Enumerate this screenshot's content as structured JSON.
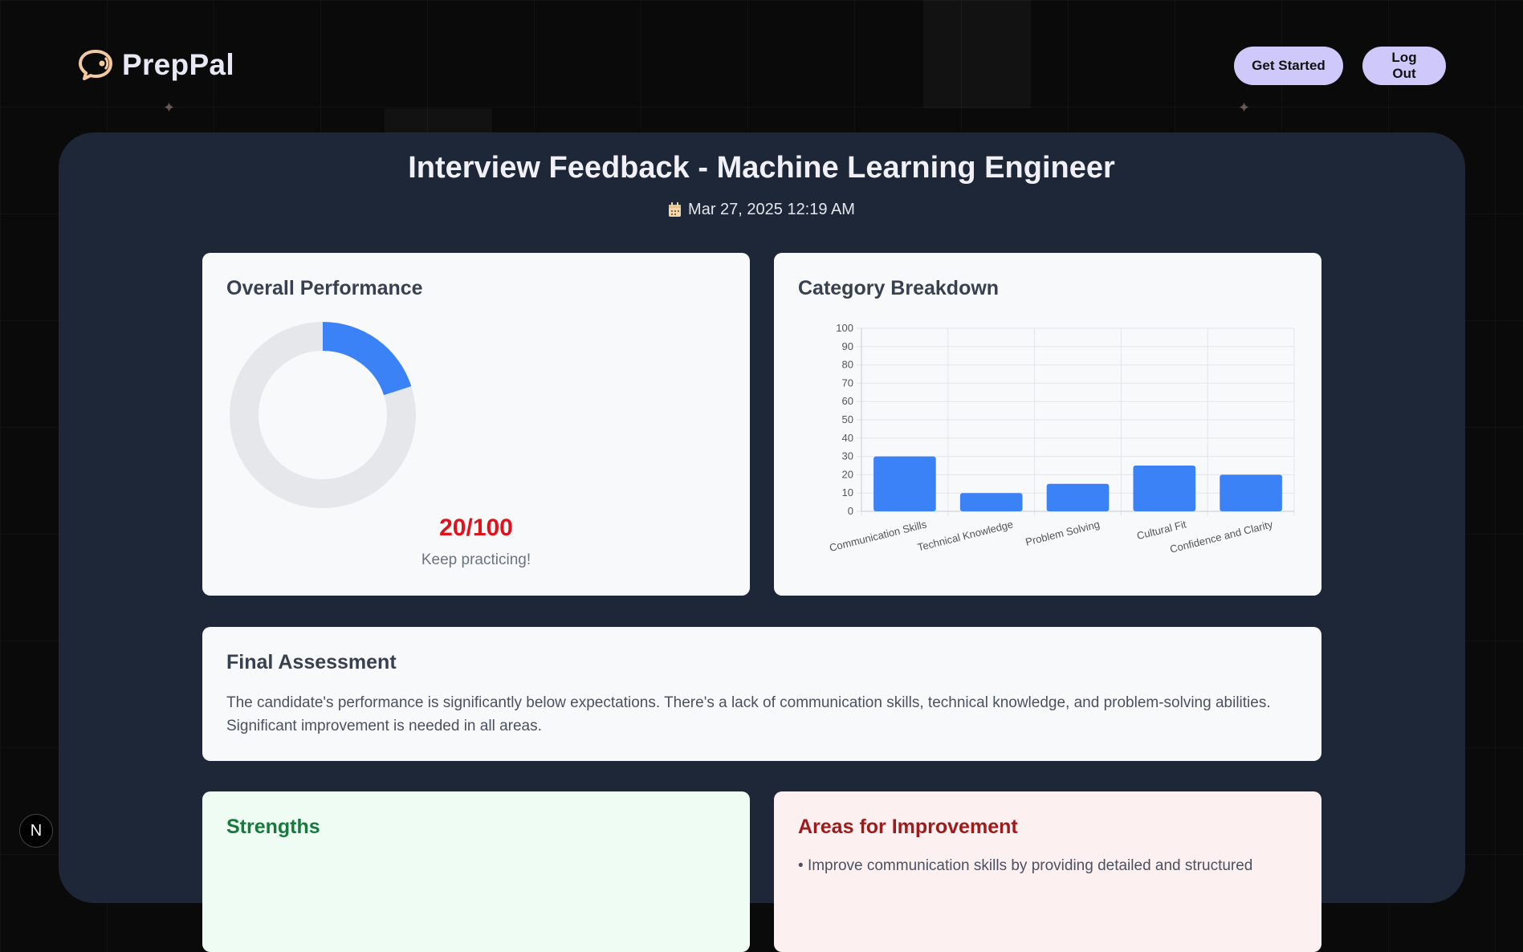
{
  "app": {
    "name": "PrepPal"
  },
  "header": {
    "get_started_label": "Get Started",
    "logout_label": "Log Out"
  },
  "page": {
    "title": "Interview Feedback - Machine Learning Engineer",
    "date": "Mar 27, 2025 12:19 AM"
  },
  "overall": {
    "heading": "Overall Performance",
    "score_text": "20/100",
    "score_fraction": 0.2,
    "message": "Keep practicing!",
    "colors": {
      "fill": "#3b82f6",
      "track": "#e5e7eb",
      "score": "#e0131d"
    }
  },
  "category": {
    "heading": "Category Breakdown"
  },
  "chart_data": {
    "type": "bar",
    "categories": [
      "Communication Skills",
      "Technical Knowledge",
      "Problem Solving",
      "Cultural Fit",
      "Confidence and Clarity"
    ],
    "values": [
      30,
      10,
      15,
      25,
      20
    ],
    "yticks": [
      "0",
      "10",
      "20",
      "30",
      "40",
      "50",
      "60",
      "70",
      "80",
      "90",
      "100"
    ],
    "ylim": [
      0,
      100
    ],
    "grid": true,
    "color": "#3b82f6"
  },
  "assessment": {
    "heading": "Final Assessment",
    "text": "The candidate's performance is significantly below expectations. There's a lack of communication skills, technical knowledge, and problem-solving abilities. Significant improvement is needed in all areas."
  },
  "strengths": {
    "heading": "Strengths",
    "color": "#177a3c",
    "bg": "#effcf3"
  },
  "improvement": {
    "heading": "Areas for Improvement",
    "partial_text": "Improve communication skills by providing detailed and structured",
    "color": "#9f1a1a",
    "bg": "#fdf0f0"
  },
  "dev": {
    "badge_letter": "N"
  }
}
